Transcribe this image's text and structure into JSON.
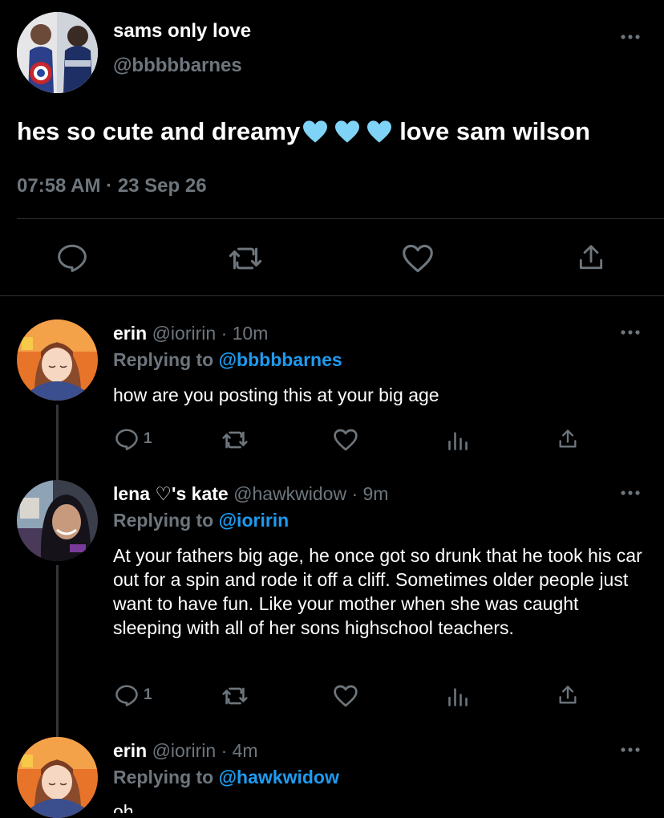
{
  "main_tweet": {
    "display_name": "sams only love",
    "handle": "@bbbbbarnes",
    "text": "hes so cute and dreamy",
    "text_suffix": "love sam wilson",
    "timestamp": "07:58 AM · 23 Sep 26"
  },
  "replies": [
    {
      "display_name": "erin",
      "handle": "@ioririn",
      "time": "· 10m",
      "replying_prefix": "Replying to",
      "replying_to": "@bbbbbarnes",
      "text": "how are you posting this at your big age",
      "reply_count": "1"
    },
    {
      "display_name": "lena ♡'s kate",
      "handle": "@hawkwidow",
      "time": "· 9m",
      "replying_prefix": "Replying to",
      "replying_to": "@ioririn",
      "text": "At your fathers big age, he once got so drunk that he took his car out for a spin and rode it off a cliff. Sometimes older people just want to have fun. Like your mother when she was caught sleeping with all of her sons highschool teachers.",
      "reply_count": "1"
    },
    {
      "display_name": "erin",
      "handle": "@ioririn",
      "time": "· 4m",
      "replying_prefix": "Replying to",
      "replying_to": "@hawkwidow",
      "text": "oh"
    }
  ],
  "colors": {
    "background": "#000000",
    "link": "#1d9bf0",
    "muted": "#6e767d",
    "heart_emoji": "#7fd3f7"
  },
  "icons": [
    "more-icon",
    "reply-icon",
    "retweet-icon",
    "like-icon",
    "share-icon",
    "analytics-icon",
    "blue-heart-emoji"
  ]
}
